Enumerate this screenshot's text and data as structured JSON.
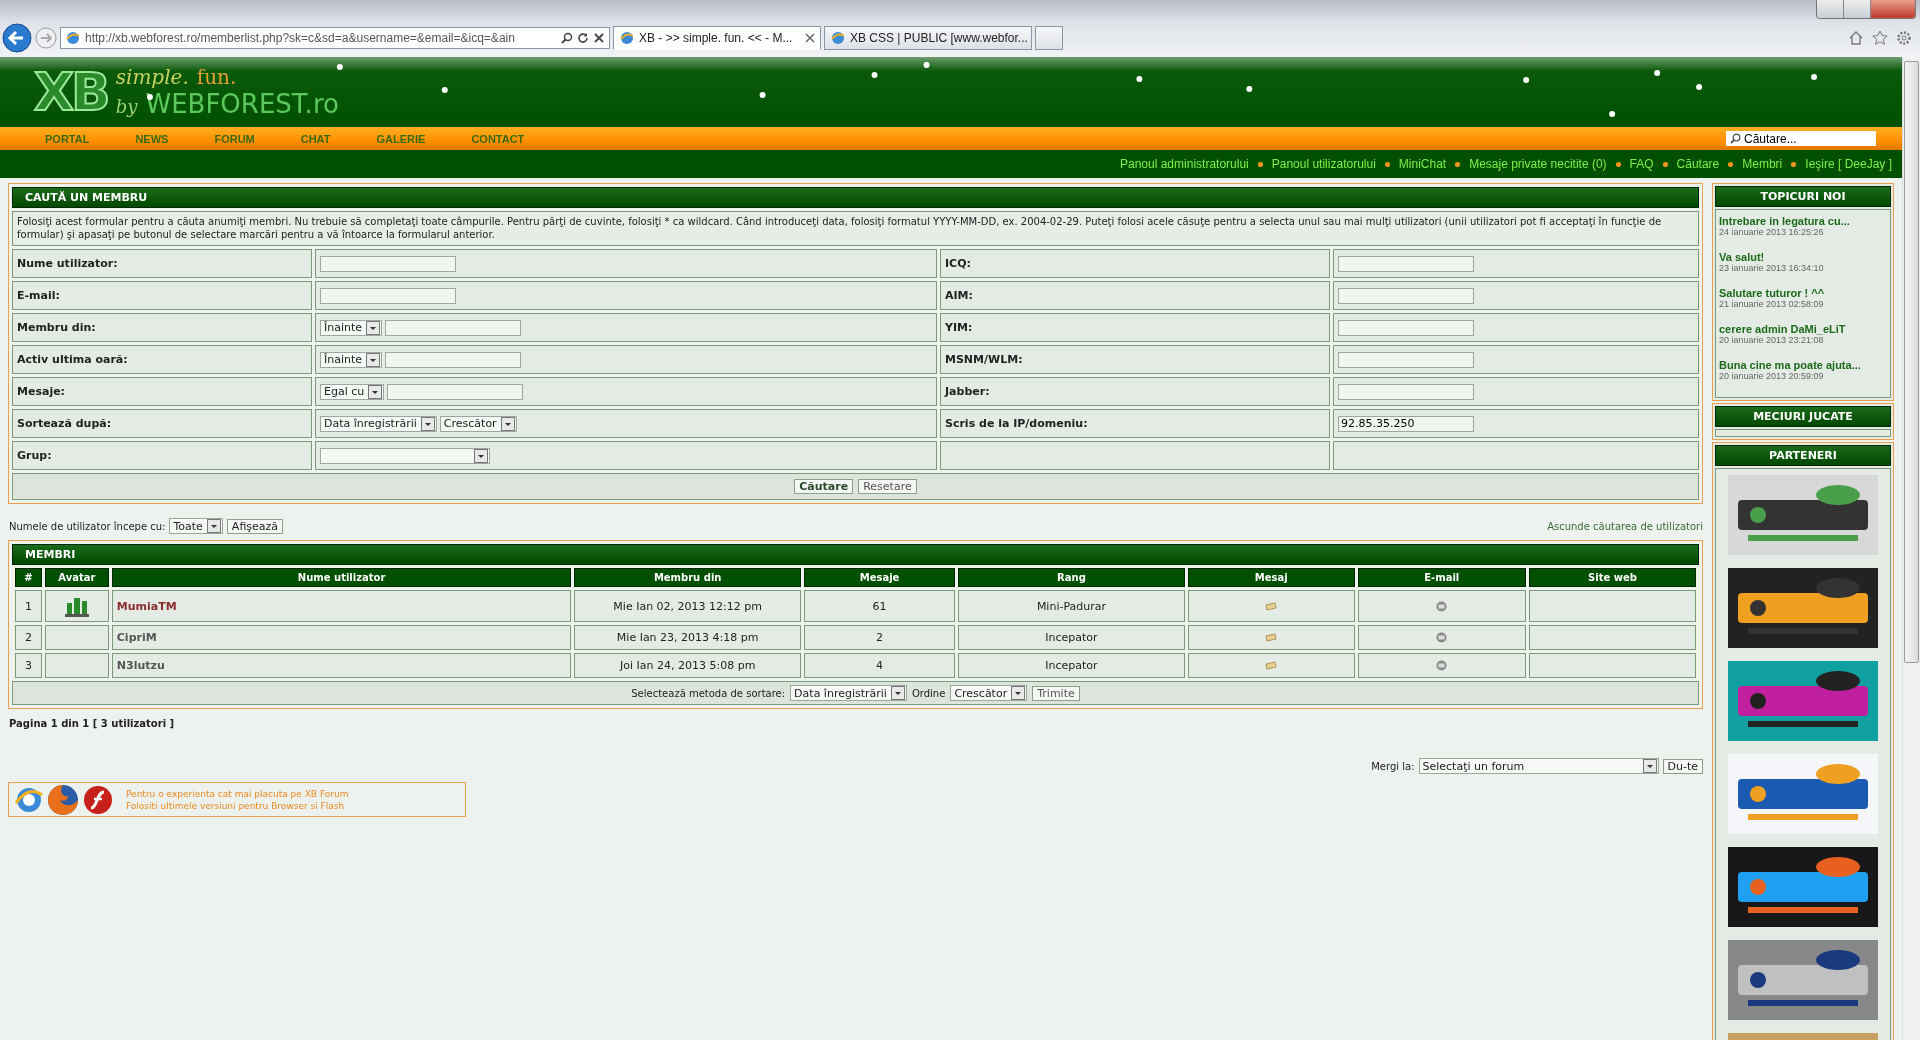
{
  "browser": {
    "url": "http://xb.webforest.ro/memberlist.php?sk=c&sd=a&username=&email=&icq=&ain",
    "tabs": [
      {
        "title": "XB - >> simple. fun. << - M...",
        "selected": true
      },
      {
        "title": "XB CSS | PUBLIC [www.webfor...",
        "selected": false
      }
    ]
  },
  "header": {
    "logo_mark": "XB",
    "logo_tagline": "simple.",
    "logo_fun": "fun.",
    "logo_by": "by",
    "logo_site": "WEBFOREST.ro"
  },
  "nav": {
    "items": [
      "PORTAL",
      "NEWS",
      "FORUM",
      "CHAT",
      "GALERIE",
      "CONTACT"
    ],
    "search": {
      "placeholder": "Căutare..."
    }
  },
  "user_links": [
    "Panoul administratorului",
    "Panoul utilizatorului",
    "MiniChat",
    "Mesaje private necitite (0)",
    "FAQ",
    "Căutare",
    "Membri",
    "Ieşire [ DeeJay ]"
  ],
  "search_form": {
    "title": "CAUTĂ UN MEMBRU",
    "description": "Folosiţi acest formular pentru a căuta anumiţi membri. Nu trebuie să completaţi toate câmpurile. Pentru părţi de cuvinte, folosiţi * ca wildcard. Când introduceţi data, folosiţi formatul YYYY-MM-DD, ex. 2004-02-29. Puteţi folosi acele căsuţe pentru a selecta unul sau mai mulţi utilizatori (unii utilizatori pot fi acceptaţi în funcţie de formular) şi apasaţi pe butonul de selectare marcări pentru a vă întoarce la formularul anterior.",
    "rows": [
      {
        "left": {
          "label": "Nume utilizator:",
          "controls": [
            {
              "kind": "text"
            }
          ]
        },
        "right": {
          "label": "ICQ:",
          "controls": [
            {
              "kind": "text"
            }
          ]
        }
      },
      {
        "left": {
          "label": "E-mail:",
          "controls": [
            {
              "kind": "text"
            }
          ]
        },
        "right": {
          "label": "AIM:",
          "controls": [
            {
              "kind": "text"
            }
          ]
        }
      },
      {
        "left": {
          "label": "Membru din:",
          "controls": [
            {
              "kind": "select",
              "value": "Înainte"
            },
            {
              "kind": "text"
            }
          ]
        },
        "right": {
          "label": "YIM:",
          "controls": [
            {
              "kind": "text"
            }
          ]
        }
      },
      {
        "left": {
          "label": "Activ ultima oară:",
          "controls": [
            {
              "kind": "select",
              "value": "Înainte"
            },
            {
              "kind": "text"
            }
          ]
        },
        "right": {
          "label": "MSNM/WLM:",
          "controls": [
            {
              "kind": "text"
            }
          ]
        }
      },
      {
        "left": {
          "label": "Mesaje:",
          "controls": [
            {
              "kind": "select",
              "value": "Egal cu"
            },
            {
              "kind": "text"
            }
          ]
        },
        "right": {
          "label": "Jabber:",
          "controls": [
            {
              "kind": "text"
            }
          ]
        }
      },
      {
        "left": {
          "label": "Sortează după:",
          "controls": [
            {
              "kind": "select",
              "value": "Data înregistrării"
            },
            {
              "kind": "select",
              "value": "Crescător"
            }
          ]
        },
        "right": {
          "label": "Scris de la IP/domeniu:",
          "controls": [
            {
              "kind": "text",
              "value": "92.85.35.250"
            }
          ]
        }
      },
      {
        "left": {
          "label": "Grup:",
          "controls": [
            {
              "kind": "select"
            }
          ]
        }
      }
    ],
    "buttons": [
      {
        "label": "Căutare",
        "primary": true
      },
      {
        "label": "Resetare",
        "primary": false
      }
    ]
  },
  "letter_filter": {
    "label": "Numele de utilizator începe cu:",
    "select": "Toate",
    "button": "Afişează",
    "hide_link": "Ascunde căutarea de utilizatori"
  },
  "members": {
    "title": "MEMBRI",
    "columns": [
      "#",
      "Avatar",
      "Nume utilizator",
      "Membru din",
      "Mesaje",
      "Rang",
      "Mesaj",
      "E-mail",
      "Site web"
    ],
    "rows": [
      {
        "num": "1",
        "avatar": true,
        "name": "MumiaTM",
        "color": "#8c2d2d",
        "joined": "Mie Ian 02, 2013 12:12 pm",
        "posts": "61",
        "rank": "Mini-Padurar"
      },
      {
        "num": "2",
        "avatar": false,
        "name": "CipriM",
        "color": "#555555",
        "joined": "Mie Ian 23, 2013 4:18 pm",
        "posts": "2",
        "rank": "Incepator"
      },
      {
        "num": "3",
        "avatar": false,
        "name": "N3lutzu",
        "color": "#555555",
        "joined": "Joi Ian 24, 2013 5:08 pm",
        "posts": "4",
        "rank": "Incepator"
      }
    ],
    "sort": {
      "label": "Selectează metoda de sortare:",
      "method": "Data înregistrării",
      "order_label": "Ordine",
      "order": "Crescător",
      "button": "Trimite"
    }
  },
  "pagination": "Pagina 1 din 1 [ 3 utilizatori ]",
  "jump": {
    "label": "Mergi la:",
    "select": "Selectaţi un forum",
    "button": "Du-te"
  },
  "notice": [
    "Pentru o experienta cat mai placuta pe XB Forum",
    "Folositi ultimele versiuni pentru Browser si Flash"
  ],
  "sidebar": {
    "topics_title": "TOPICURI NOI",
    "topics": [
      {
        "title": "Intrebare in legatura cu...",
        "date": "24 ianuarie 2013 16:25:26"
      },
      {
        "title": "Va salut!",
        "date": "23 ianuarie 2013 16:34:10"
      },
      {
        "title": "Salutare tuturor ! ^^",
        "date": "21 ianuarie 2013 02:58:09"
      },
      {
        "title": "cerere admin DaMi_eLiT",
        "date": "20 ianuarie 2013 23:21:08"
      },
      {
        "title": "Buna cine ma poate ajuta...",
        "date": "20 ianuarie 2013 20:59:09"
      }
    ],
    "matches_title": "MECIURI JUCATE",
    "partners_title": "PARTENERI"
  }
}
